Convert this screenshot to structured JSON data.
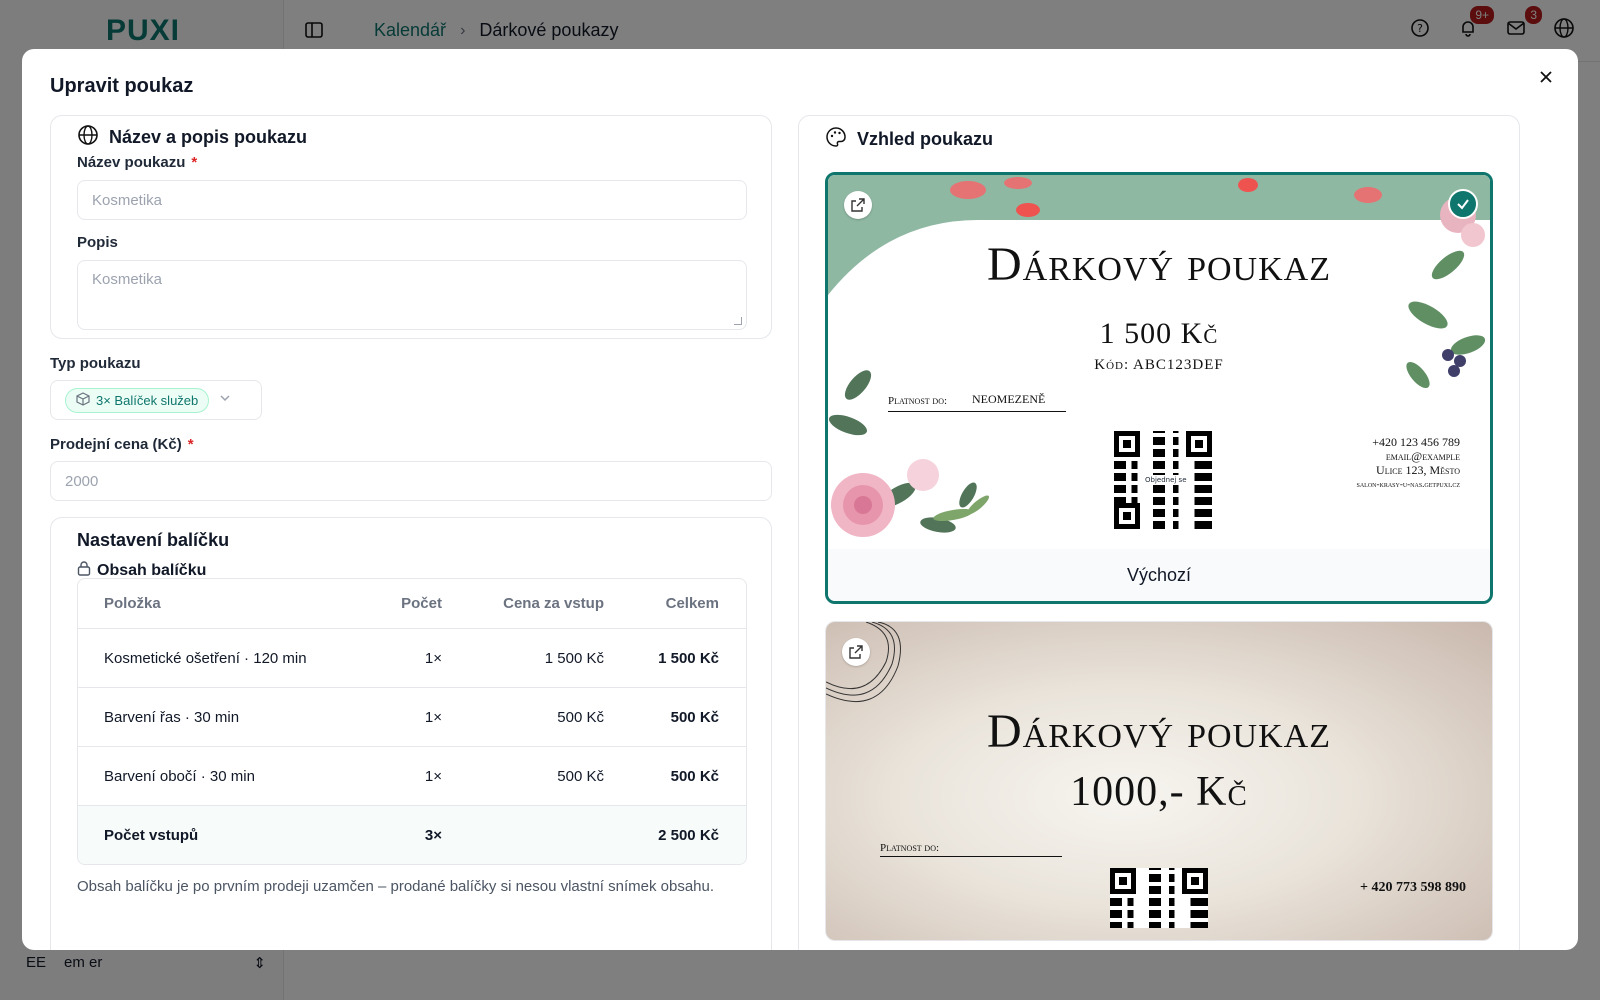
{
  "app": {
    "logo": "PUXI",
    "breadcrumb": {
      "parent": "Kalendář",
      "current": "Dárkové poukazy"
    },
    "notifications_badge": "9+",
    "mail_badge": "3",
    "user": {
      "initials": "EE",
      "name": "em er"
    }
  },
  "modal": {
    "title": "Upravit poukaz",
    "basic": {
      "heading": "Název a popis poukazu",
      "name_label": "Název poukazu",
      "name_placeholder": "Kosmetika",
      "desc_label": "Popis",
      "desc_placeholder": "Kosmetika",
      "required_mark": "*"
    },
    "type": {
      "label": "Typ poukazu",
      "value": "3× Balíček služeb"
    },
    "price": {
      "label": "Prodejní cena (Kč)",
      "placeholder": "2000",
      "required_mark": "*"
    },
    "package": {
      "title": "Nastavení balíčku",
      "subtitle": "Obsah balíčku",
      "columns": {
        "item": "Položka",
        "count": "Počet",
        "price": "Cena za vstup",
        "total": "Celkem"
      },
      "rows": [
        {
          "item": "Kosmetické ošetření · 120 min",
          "count": "1×",
          "price": "1 500 Kč",
          "total": "1 500 Kč"
        },
        {
          "item": "Barvení řas · 30 min",
          "count": "1×",
          "price": "500 Kč",
          "total": "500 Kč"
        },
        {
          "item": "Barvení obočí · 30 min",
          "count": "1×",
          "price": "500 Kč",
          "total": "500 Kč"
        }
      ],
      "summary": {
        "label": "Počet vstupů",
        "count": "3×",
        "total": "2 500 Kč"
      },
      "note": "Obsah balíčku je po prvním prodeji uzamčen – prodané balíčky si nesou vlastní snímek obsahu."
    },
    "appearance": {
      "heading": "Vzhled poukazu",
      "templates": [
        {
          "label": "Výchozí",
          "selected": true,
          "title": "Dárkový poukaz",
          "amount": "1 500 Kč",
          "code": "Kód: ABC123DEF",
          "validity_label": "Platnost do:",
          "validity_value": "neomezeně",
          "qr_caption": "Objednej se",
          "contact_phone": "+420 123 456 789",
          "contact_email": "email@example",
          "contact_address": "Ulice 123, Město",
          "contact_web": "salon-krasy-u-nas.getpuxi.cz"
        },
        {
          "title": "Dárkový poukaz",
          "amount": "1000,- Kč",
          "validity_label": "Platnost do:",
          "contact_phone": "+ 420 773 598 890"
        }
      ]
    }
  }
}
